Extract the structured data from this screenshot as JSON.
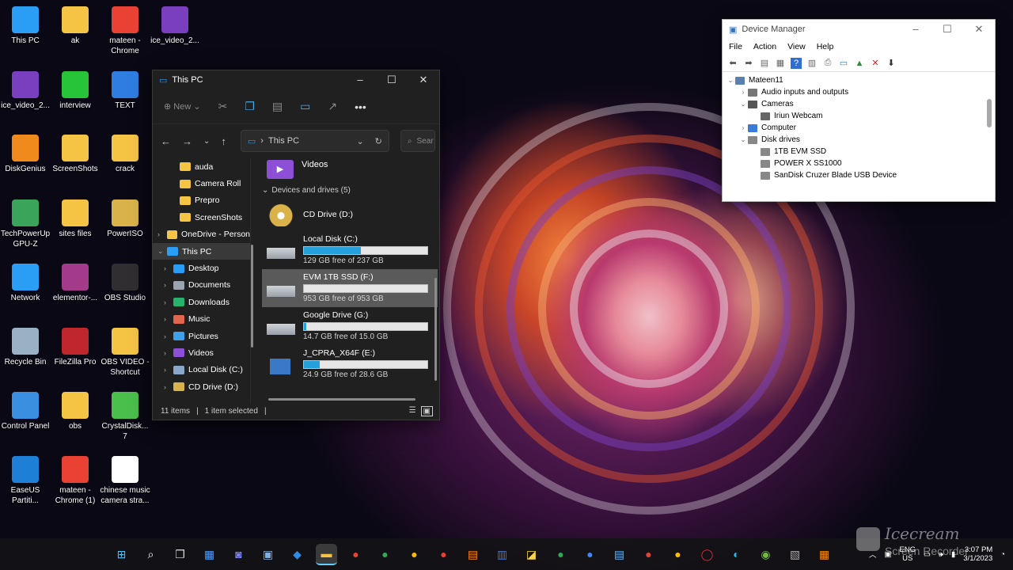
{
  "desktop": {
    "icons": [
      {
        "label": "This PC",
        "icon": "monitor-icon",
        "color": "#2a9df4"
      },
      {
        "label": "ak",
        "icon": "folder-icon",
        "color": "#f5c445"
      },
      {
        "label": "mateen - Chrome",
        "icon": "chrome-icon",
        "color": "#e94235"
      },
      {
        "label": "ice_video_2...",
        "icon": "video-file-icon",
        "color": "#7a3fbf"
      },
      {
        "label": "ice_video_2...",
        "icon": "video-file-icon",
        "color": "#7a3fbf"
      },
      {
        "label": "interview",
        "icon": "folder-icon",
        "color": "#27c43a"
      },
      {
        "label": "TEXT",
        "icon": "folder-icon",
        "color": "#2f7de1"
      },
      {
        "label": "DiskGenius",
        "icon": "diskgenius-icon",
        "color": "#f08a1c"
      },
      {
        "label": "ScreenShots",
        "icon": "folder-icon",
        "color": "#f5c445"
      },
      {
        "label": "crack",
        "icon": "folder-icon",
        "color": "#f5c445"
      },
      {
        "label": "TechPowerUp GPU-Z",
        "icon": "gpuz-icon",
        "color": "#3aa55a"
      },
      {
        "label": "sites files",
        "icon": "folder-icon",
        "color": "#f5c445"
      },
      {
        "label": "PowerISO",
        "icon": "disc-icon",
        "color": "#d9b24a"
      },
      {
        "label": "Network",
        "icon": "network-icon",
        "color": "#2a9df4"
      },
      {
        "label": "elementor-...",
        "icon": "winrar-icon",
        "color": "#a33a8a"
      },
      {
        "label": "OBS Studio",
        "icon": "obs-icon",
        "color": "#302e31"
      },
      {
        "label": "Recycle Bin",
        "icon": "recycle-bin-icon",
        "color": "#9ab0c4"
      },
      {
        "label": "FileZilla Pro",
        "icon": "filezilla-icon",
        "color": "#c0272d"
      },
      {
        "label": "OBS VIDEO - Shortcut",
        "icon": "folder-icon",
        "color": "#f5c445"
      },
      {
        "label": "Control Panel",
        "icon": "control-panel-icon",
        "color": "#3b8fe0"
      },
      {
        "label": "obs",
        "icon": "folder-icon",
        "color": "#f5c445"
      },
      {
        "label": "CrystalDisk... 7",
        "icon": "crystaldisk-icon",
        "color": "#4bbf4b"
      },
      {
        "label": "EaseUS Partiti...",
        "icon": "easeus-icon",
        "color": "#1e7fd6"
      },
      {
        "label": "mateen - Chrome (1)",
        "icon": "chrome-icon",
        "color": "#e94235"
      },
      {
        "label": "chinese music camera stra...",
        "icon": "media-file-icon",
        "color": "#ffffff"
      }
    ]
  },
  "explorer": {
    "title": "This PC",
    "new_label": "New",
    "address": "This PC",
    "search_placeholder": "Sear",
    "nav": [
      {
        "label": "auda",
        "indent": 2,
        "color": "#f5c445",
        "chev": ""
      },
      {
        "label": "Camera Roll",
        "indent": 2,
        "color": "#f5c445",
        "chev": ""
      },
      {
        "label": "Prepro",
        "indent": 2,
        "color": "#f5c445",
        "chev": ""
      },
      {
        "label": "ScreenShots",
        "indent": 2,
        "color": "#f5c445",
        "chev": ""
      },
      {
        "label": "OneDrive - Person",
        "indent": 0,
        "color": "#f5c445",
        "chev": "›"
      },
      {
        "label": "This PC",
        "indent": 0,
        "color": "#2a9df4",
        "chev": "⌄",
        "selected": true
      },
      {
        "label": "Desktop",
        "indent": 1,
        "color": "#2a9df4",
        "chev": "›"
      },
      {
        "label": "Documents",
        "indent": 1,
        "color": "#9aa4b0",
        "chev": "›"
      },
      {
        "label": "Downloads",
        "indent": 1,
        "color": "#27b36b",
        "chev": "›"
      },
      {
        "label": "Music",
        "indent": 1,
        "color": "#e0664e",
        "chev": "›"
      },
      {
        "label": "Pictures",
        "indent": 1,
        "color": "#3ea0e8",
        "chev": "›"
      },
      {
        "label": "Videos",
        "indent": 1,
        "color": "#8c4fd6",
        "chev": "›"
      },
      {
        "label": "Local Disk (C:)",
        "indent": 1,
        "color": "#8aa6c8",
        "chev": "›"
      },
      {
        "label": "CD Drive (D:)",
        "indent": 1,
        "color": "#d9b24a",
        "chev": "›"
      }
    ],
    "videos_label": "Videos",
    "group_label": "Devices and drives (5)",
    "drives": [
      {
        "name": "CD Drive (D:)",
        "free": "",
        "fill": null,
        "icon": "cd-drive-icon"
      },
      {
        "name": "Local Disk (C:)",
        "free": "129 GB free of 237 GB",
        "fill": 0.46,
        "icon": "windows-drive-icon"
      },
      {
        "name": "EVM 1TB SSD (F:)",
        "free": "953 GB free of 953 GB",
        "fill": 0.0,
        "icon": "hard-drive-icon",
        "selected": true
      },
      {
        "name": "Google Drive (G:)",
        "free": "14.7 GB free of 15.0 GB",
        "fill": 0.02,
        "icon": "hard-drive-icon"
      },
      {
        "name": "J_CPRA_X64F (E:)",
        "free": "24.9 GB free of 28.6 GB",
        "fill": 0.13,
        "icon": "usb-drive-icon"
      }
    ],
    "status": {
      "items": "11 items",
      "selected": "1 item selected"
    }
  },
  "devmgr": {
    "title": "Device Manager",
    "menu": [
      "File",
      "Action",
      "View",
      "Help"
    ],
    "tree": [
      {
        "label": "Mateen11",
        "level": 0,
        "tw": "⌄",
        "icon": "computer-icon"
      },
      {
        "label": "Audio inputs and outputs",
        "level": 1,
        "tw": "›",
        "icon": "speaker-icon"
      },
      {
        "label": "Cameras",
        "level": 1,
        "tw": "⌄",
        "icon": "camera-icon"
      },
      {
        "label": "Iriun Webcam",
        "level": 2,
        "tw": "",
        "icon": "webcam-icon"
      },
      {
        "label": "Computer",
        "level": 1,
        "tw": "›",
        "icon": "monitor-icon"
      },
      {
        "label": "Disk drives",
        "level": 1,
        "tw": "⌄",
        "icon": "disk-icon"
      },
      {
        "label": "1TB EVM SSD",
        "level": 2,
        "tw": "",
        "icon": "disk-icon"
      },
      {
        "label": "POWER X SS1000",
        "level": 2,
        "tw": "",
        "icon": "disk-icon"
      },
      {
        "label": "SanDisk Cruzer Blade USB Device",
        "level": 2,
        "tw": "",
        "icon": "disk-icon"
      }
    ]
  },
  "taskbar": {
    "apps": [
      {
        "name": "start-icon",
        "glyph": "⊞",
        "color": "#4cc2ff"
      },
      {
        "name": "search-icon",
        "glyph": "⌕",
        "color": "#ffffff"
      },
      {
        "name": "task-view-icon",
        "glyph": "❐",
        "color": "#dddddd"
      },
      {
        "name": "widgets-icon",
        "glyph": "▦",
        "color": "#3aa0ff"
      },
      {
        "name": "chat-icon",
        "glyph": "◙",
        "color": "#7b83eb"
      },
      {
        "name": "photos-icon",
        "glyph": "▣",
        "color": "#7fb0e0"
      },
      {
        "name": "app-icon",
        "glyph": "◆",
        "color": "#2a8ee8"
      },
      {
        "name": "file-explorer-icon",
        "glyph": "▬",
        "color": "#f5c445",
        "active": true
      },
      {
        "name": "chrome-icon",
        "glyph": "●",
        "color": "#e94235"
      },
      {
        "name": "chrome-icon",
        "glyph": "●",
        "color": "#34a853"
      },
      {
        "name": "chrome-icon",
        "glyph": "●",
        "color": "#fbbc05"
      },
      {
        "name": "chrome-icon",
        "glyph": "●",
        "color": "#e94235"
      },
      {
        "name": "app-icon",
        "glyph": "▤",
        "color": "#f08a1c"
      },
      {
        "name": "app-icon",
        "glyph": "▥",
        "color": "#3a78d8"
      },
      {
        "name": "sticky-notes-icon",
        "glyph": "◪",
        "color": "#f5d547"
      },
      {
        "name": "chrome-icon",
        "glyph": "●",
        "color": "#34a853"
      },
      {
        "name": "chrome-icon",
        "glyph": "●",
        "color": "#4285f4"
      },
      {
        "name": "notepad-icon",
        "glyph": "▤",
        "color": "#5ab4f0"
      },
      {
        "name": "chrome-icon",
        "glyph": "●",
        "color": "#e94235"
      },
      {
        "name": "chrome-icon",
        "glyph": "●",
        "color": "#fbbc05"
      },
      {
        "name": "opera-icon",
        "glyph": "◯",
        "color": "#ff1b2d"
      },
      {
        "name": "edge-icon",
        "glyph": "◐",
        "color": "#2fb7e8"
      },
      {
        "name": "utorrent-icon",
        "glyph": "◉",
        "color": "#76b83f"
      },
      {
        "name": "app-icon",
        "glyph": "▧",
        "color": "#aaaaaa"
      },
      {
        "name": "app-icon",
        "glyph": "▦",
        "color": "#f08a1c"
      }
    ],
    "lang": {
      "line1": "ENG",
      "line2": "US"
    },
    "clock": {
      "time": "3:07 PM",
      "date": "3/1/2023"
    }
  },
  "watermark": {
    "line1": "Icecream",
    "line2": "Screen Recorder"
  }
}
